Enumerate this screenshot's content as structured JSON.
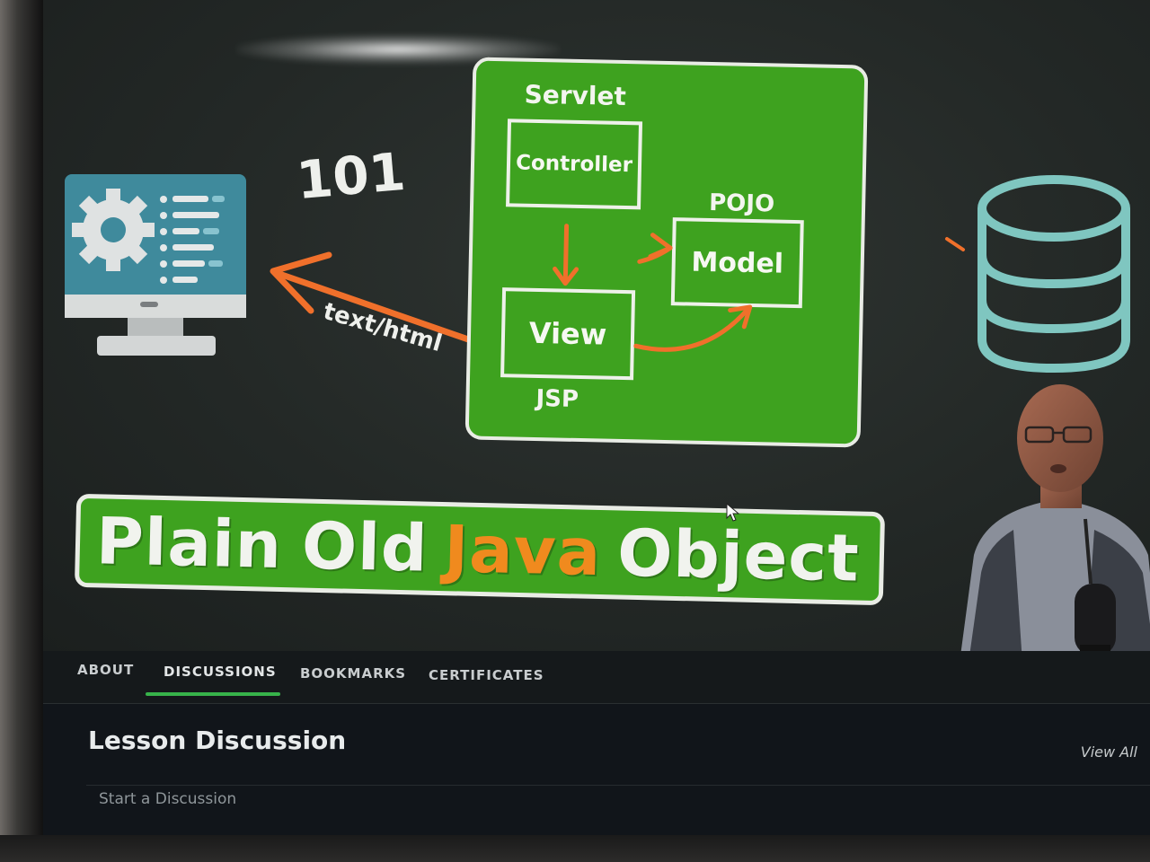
{
  "video": {
    "diagram": {
      "number": "101",
      "arrow_label": "text/html",
      "servlet_label": "Servlet",
      "controller_label": "Controller",
      "pojo_label": "POJO",
      "model_label": "Model",
      "view_label": "View",
      "jsp_label": "JSP"
    },
    "banner": {
      "word1": "Plain",
      "word2": "Old",
      "word3": "Java",
      "word4": "Object"
    },
    "colors": {
      "diagram_green": "#3ea21f",
      "accent_orange": "#f08a1e",
      "db_teal": "#7fc6c0"
    }
  },
  "tabs": {
    "about": "ABOUT",
    "discussions": "DISCUSSIONS",
    "bookmarks": "BOOKMARKS",
    "certificates": "CERTIFICATES",
    "active": "DISCUSSIONS"
  },
  "discussion": {
    "title": "Lesson Discussion",
    "view_all": "View All",
    "start_prompt": "Start a Discussion"
  }
}
